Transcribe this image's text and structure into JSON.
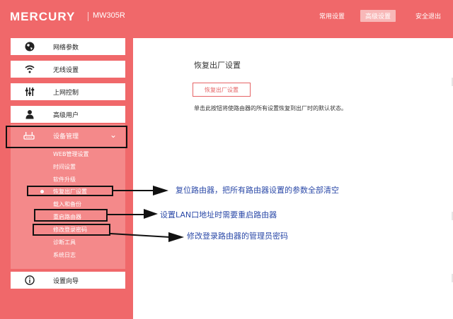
{
  "header": {
    "brand": "MERCURY",
    "model": "MW305R",
    "nav": [
      "常用设置",
      "高级设置",
      "安全退出"
    ]
  },
  "sidebar": {
    "items": [
      {
        "label": "网络参数",
        "icon": "globe-icon"
      },
      {
        "label": "无线设置",
        "icon": "wifi-icon"
      },
      {
        "label": "上网控制",
        "icon": "sliders-icon"
      },
      {
        "label": "高级用户",
        "icon": "user-icon"
      }
    ],
    "device": {
      "label": "设备管理",
      "icon": "router-icon",
      "subitems": [
        "WEB管理设置",
        "时间设置",
        "软件升级",
        "恢复出厂设置",
        "载入和备份",
        "重启路由器",
        "修改登录密码",
        "诊断工具",
        "系统日志"
      ]
    },
    "wizard": {
      "label": "设置向导",
      "icon": "info-icon"
    }
  },
  "main": {
    "title": "恢复出厂设置",
    "button": "恢复出厂设置",
    "description": "单击此按钮将使路由器的所有设置恢复到出厂时的默认状态。"
  },
  "annotations": [
    "复位路由器，把所有路由器设置的参数全部清空",
    "设置LAN口地址时需要重启路由器",
    "修改登录路由器的管理员密码"
  ],
  "colors": {
    "accent": "#f0686a",
    "panel": "#ffffff",
    "annotation": "#2c4aa8"
  }
}
